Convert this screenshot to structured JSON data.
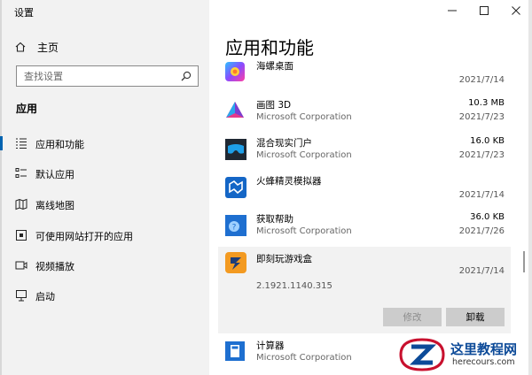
{
  "window": {
    "title": "设置"
  },
  "sidebar": {
    "home_label": "主页",
    "search_placeholder": "查找设置",
    "section_title": "应用",
    "items": [
      {
        "label": "应用和功能",
        "icon": "list-icon",
        "selected": true
      },
      {
        "label": "默认应用",
        "icon": "default-apps-icon",
        "selected": false
      },
      {
        "label": "离线地图",
        "icon": "map-icon",
        "selected": false
      },
      {
        "label": "可使用网站打开的应用",
        "icon": "web-apps-icon",
        "selected": false
      },
      {
        "label": "视频播放",
        "icon": "video-icon",
        "selected": false
      },
      {
        "label": "启动",
        "icon": "startup-icon",
        "selected": false
      }
    ]
  },
  "main": {
    "heading": "应用和功能",
    "apps": [
      {
        "name": "海螺桌面",
        "publisher": "",
        "size": "",
        "date": "2021/7/14",
        "icon": "hailuo-desktop-icon"
      },
      {
        "name": "画图 3D",
        "publisher": "Microsoft Corporation",
        "size": "10.3 MB",
        "date": "2021/7/23",
        "icon": "paint3d-icon"
      },
      {
        "name": "混合现实门户",
        "publisher": "Microsoft Corporation",
        "size": "16.0 KB",
        "date": "2021/7/23",
        "icon": "mixed-reality-icon"
      },
      {
        "name": "火蜂精灵模拟器",
        "publisher": "",
        "size": "",
        "date": "2021/7/14",
        "icon": "emulator-icon"
      },
      {
        "name": "获取帮助",
        "publisher": "Microsoft Corporation",
        "size": "36.0 KB",
        "date": "2021/7/26",
        "icon": "get-help-icon"
      },
      {
        "name": "即刻玩游戏盒",
        "publisher": "",
        "size": "",
        "date": "2021/7/14",
        "version": "2.1921.1140.315",
        "icon": "game-box-icon",
        "expanded": true
      },
      {
        "name": "计算器",
        "publisher": "Microsoft Corporation",
        "size": "",
        "date": "",
        "icon": "calculator-icon"
      }
    ],
    "modify_label": "修改",
    "uninstall_label": "卸载"
  },
  "watermark": {
    "title": "这里教程网",
    "url": "herecours.com"
  },
  "colors": {
    "accent": "#0063b1",
    "sidebar_bg": "#f2f2f2",
    "watermark_blue": "#0c4a98",
    "watermark_red": "#c8102e"
  }
}
